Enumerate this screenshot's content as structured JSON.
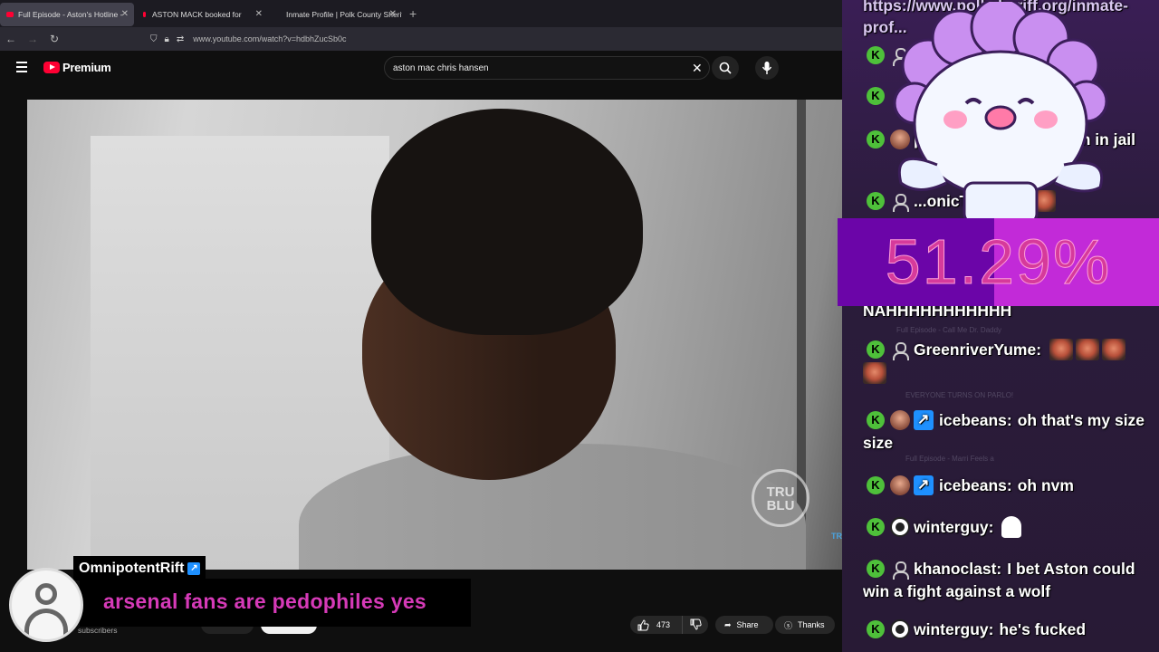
{
  "browser": {
    "tabs": [
      {
        "title": "Full Episode - Aston's Hotline -",
        "active": true
      },
      {
        "title": "ASTON MACK booked for",
        "active": false
      },
      {
        "title": "Inmate Profile | Polk County Sheriff",
        "active": false
      }
    ],
    "new_tab": "+",
    "url": "www.youtube.com/watch?v=hdbhZucSb0c"
  },
  "youtube": {
    "logo_text": "Premium",
    "search_query": "aston mac chris hansen",
    "clear_label": "✕",
    "like_count": "473",
    "share_label": "Share",
    "thanks_label": "Thanks",
    "subscribers_label": "subscribers",
    "watermark": "TRU BLU",
    "watermark_small": "TRU BLU"
  },
  "tts": {
    "username": "OmnipotentRift",
    "badge": "↗",
    "message": "arsenal fans are pedophiles yes"
  },
  "chat": {
    "ghost_title": "Full Episode - Call Me Dr. Daddy",
    "ghost_title2": "EVERYONE TURNS ON PARLO!",
    "ghost_title3": "Full Episode - Marri Feels a",
    "link_text": "https://www.polksheriff.org/inmate-prof...",
    "messages": [
      {
        "user": "p",
        "text": "...onth in jail"
      },
      {
        "user": "...onicT...kert1:",
        "text": ""
      },
      {
        "user": "",
        "text": "NAHHHHHHHHHHH"
      },
      {
        "user": "GreenriverYume:",
        "text": ""
      },
      {
        "user": "icebeans:",
        "text": "oh that's my size"
      },
      {
        "user": "icebeans:",
        "text": "oh nvm"
      },
      {
        "user": "winterguy:",
        "text": ""
      },
      {
        "user": "khanoclast:",
        "text": "I bet Aston could win a fight against a wolf"
      },
      {
        "user": "winterguy:",
        "text": "he's fucked"
      }
    ],
    "kick_glyph": "K"
  },
  "percent": {
    "value_text": "51.29%",
    "fill_fraction": 0.5129
  },
  "colors": {
    "youtube_red": "#ff0033",
    "kick_green": "#4ec03a",
    "tts_pink": "#d63ab8",
    "percent_purple": "#6b05a8",
    "percent_fill": "#c22ad8"
  }
}
